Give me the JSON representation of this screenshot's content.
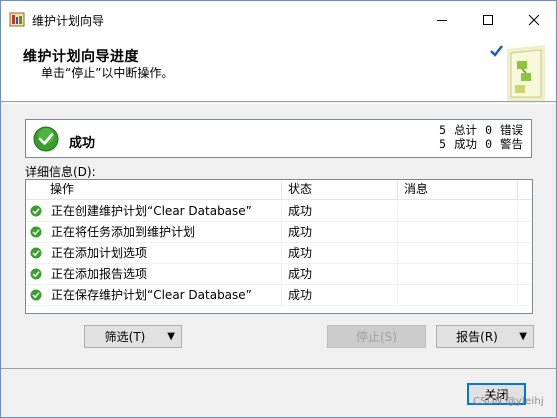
{
  "window": {
    "title": "维护计划向导"
  },
  "header": {
    "title": "维护计划向导进度",
    "subtitle": "单击“停止”以中断操作。"
  },
  "status": {
    "text": "成功",
    "total_count": "5",
    "total_label": "总计",
    "success_count": "5",
    "success_label": "成功",
    "error_count": "0",
    "error_label": "错误",
    "warning_count": "0",
    "warning_label": "警告"
  },
  "details": {
    "label": "详细信息(D):",
    "columns": {
      "operation": "操作",
      "status": "状态",
      "message": "消息"
    },
    "rows": [
      {
        "operation": "正在创建维护计划“Clear Database”",
        "status": "成功",
        "message": ""
      },
      {
        "operation": "正在将任务添加到维护计划",
        "status": "成功",
        "message": ""
      },
      {
        "operation": "正在添加计划选项",
        "status": "成功",
        "message": ""
      },
      {
        "operation": "正在添加报告选项",
        "status": "成功",
        "message": ""
      },
      {
        "operation": "正在保存维护计划“Clear Database”",
        "status": "成功",
        "message": ""
      }
    ]
  },
  "buttons": {
    "filter": "筛选(T)",
    "stop": "停止(S)",
    "report": "报告(R)",
    "close": "关闭"
  },
  "watermark": "CSDN @yleihj",
  "colors": {
    "success_green": "#3a9e2f",
    "focus_blue": "#0078d7"
  }
}
